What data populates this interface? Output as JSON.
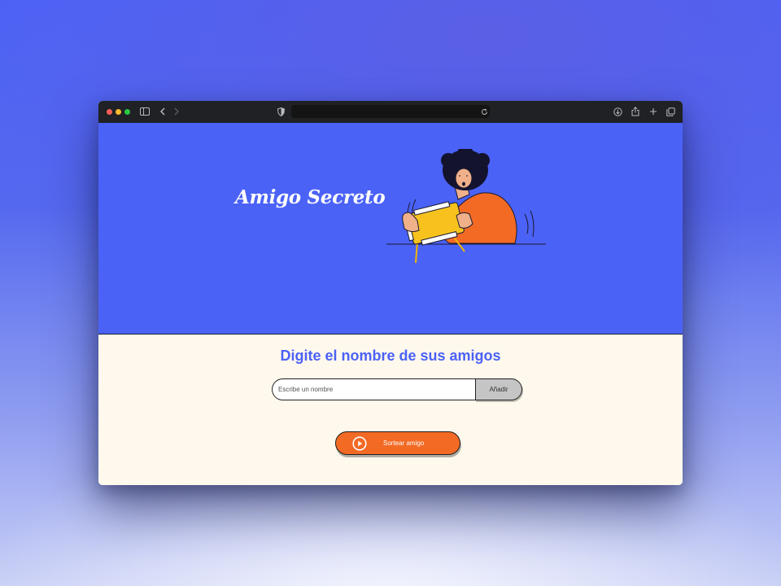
{
  "browser": {
    "traffic_light_colors": [
      "#fe5f57",
      "#febc2e",
      "#28c840"
    ],
    "icons": [
      "sidebar-icon",
      "back-icon",
      "forward-icon",
      "privacy-shield-icon",
      "reload-icon",
      "download-icon",
      "share-icon",
      "new-tab-icon",
      "tabs-overview-icon"
    ],
    "url": ""
  },
  "hero": {
    "title": "Amigo Secreto",
    "background_color": "#4b62f7",
    "illustration": "person-playing-handheld-console"
  },
  "main": {
    "heading": "Digite el nombre de sus amigos",
    "name_input": {
      "placeholder": "Escribe un nombre",
      "value": ""
    },
    "add_button_label": "Añadir",
    "draw_button_label": "Sortear amigo",
    "draw_button_icon": "play-circle-icon",
    "accent_color": "#f26a24",
    "background_color": "#fef8ed"
  }
}
